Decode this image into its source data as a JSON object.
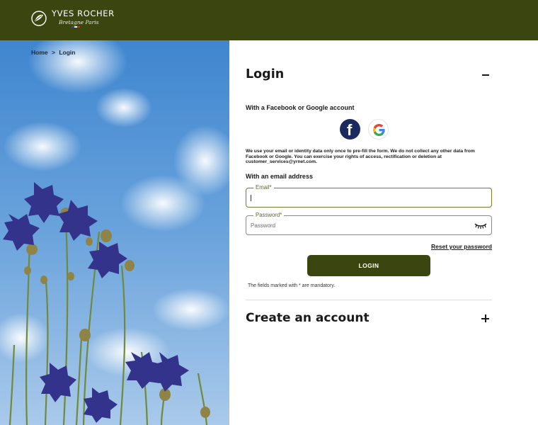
{
  "header": {
    "brand": "YVES ROCHER",
    "brand_sub": "Bretagne Paris",
    "colors": {
      "background": "#3b4510"
    }
  },
  "breadcrumb": {
    "items": [
      "Home",
      ">",
      "Login"
    ]
  },
  "login": {
    "title": "Login",
    "social_title": "With a Facebook or Google account",
    "facebook_icon": "facebook-icon",
    "google_icon": "google-icon",
    "disclaimer": "We use your email or identity data only once to pre-fill the form. We do not collect any other data from Facebook or Google. You can exercise your rights of access, rectification or deletion at customer_services@yrnet.com.",
    "email_section_title": "With an email address",
    "email_label": "Email*",
    "email_value": "",
    "password_label": "Password*",
    "password_placeholder": "Password",
    "password_toggle_icon": "eye-closed-icon",
    "reset_link": "Reset your password",
    "submit_label": "LOGIN",
    "mandatory_note": "The fields marked with * are mandatory.",
    "accent_color": "#3b4510"
  },
  "create_account": {
    "title": "Create an account",
    "expand_icon": "plus-icon"
  }
}
